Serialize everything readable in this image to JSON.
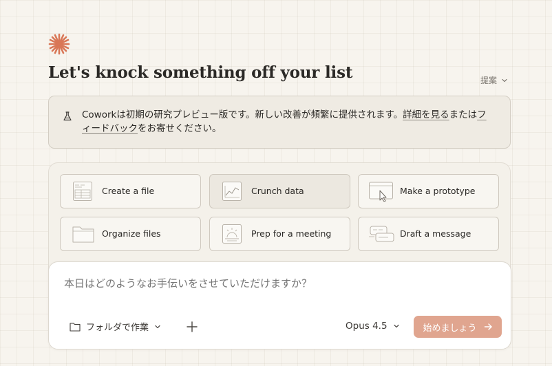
{
  "header": {
    "logo_icon": "sparkle-burst-icon",
    "title": "Let's knock something off your list",
    "suggest_label": "提案"
  },
  "banner": {
    "icon": "flask-icon",
    "part1": "Coworkは初期の研究プレビュー版です。新しい改善が頻繁に提供されます。",
    "link1": "詳細を見る",
    "part2": "または",
    "link2": "フィードバック",
    "part3": "をお寄せください。"
  },
  "tasks": [
    {
      "label": "Create a file",
      "icon": "file-table-icon"
    },
    {
      "label": "Crunch data",
      "icon": "chart-icon"
    },
    {
      "label": "Make a prototype",
      "icon": "prototype-window-icon"
    },
    {
      "label": "Organize files",
      "icon": "folder-icon"
    },
    {
      "label": "Prep for a meeting",
      "icon": "meeting-icon"
    },
    {
      "label": "Draft a message",
      "icon": "message-bubbles-icon"
    }
  ],
  "composer": {
    "placeholder": "本日はどのようなお手伝いをさせていただけますか？",
    "folder_label": "フォルダで作業",
    "model_label": "Opus 4.5",
    "start_label": "始めましょう"
  },
  "colors": {
    "accent": "#d97757",
    "start_button": "#e0a58f",
    "background": "#f7f4ee"
  }
}
